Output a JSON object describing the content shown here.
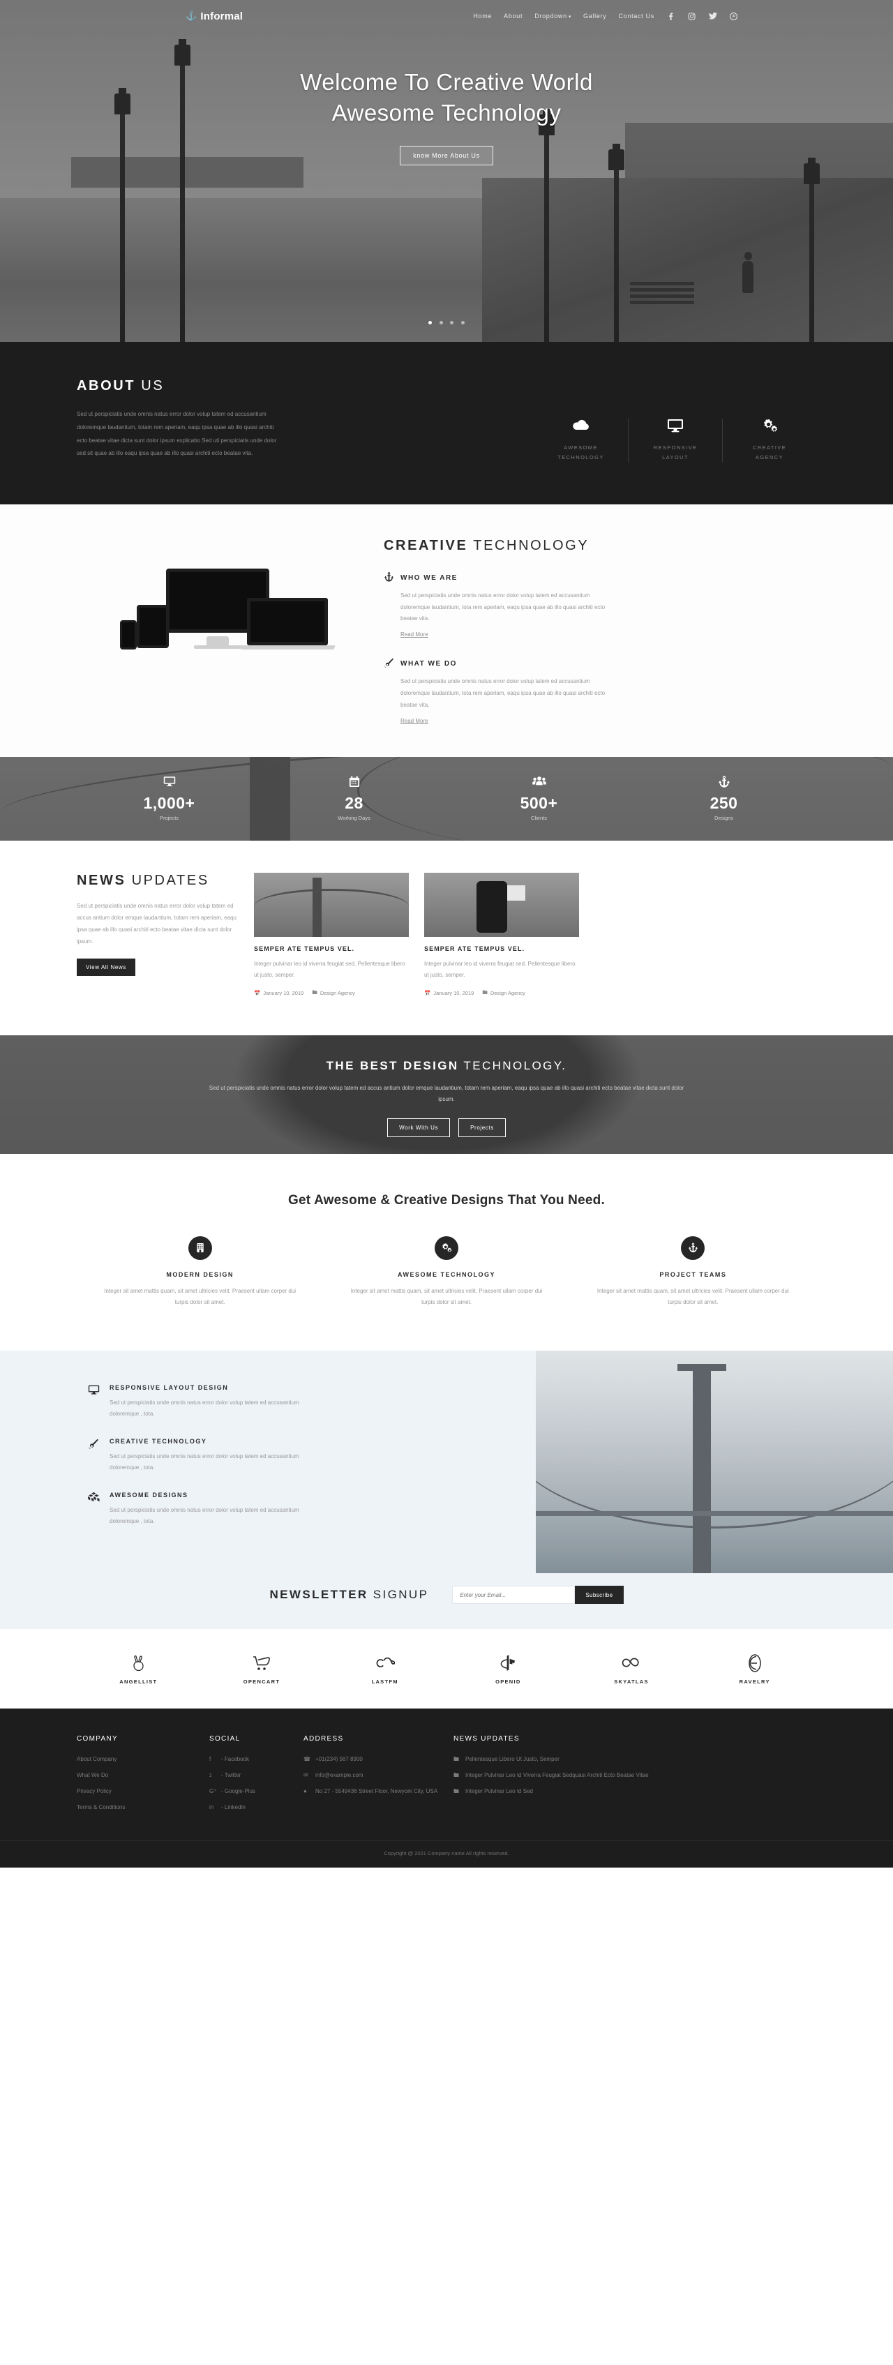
{
  "header": {
    "brand": "Informal",
    "brand_icon": "anchor-icon",
    "nav": [
      {
        "label": "Home"
      },
      {
        "label": "About"
      },
      {
        "label": "Dropdown",
        "caret": "▾"
      },
      {
        "label": "Gallery"
      },
      {
        "label": "Contact Us"
      }
    ],
    "social": [
      {
        "name": "facebook-icon",
        "glyph": "f"
      },
      {
        "name": "instagram-icon",
        "glyph": "▣"
      },
      {
        "name": "twitter-icon",
        "glyph": "ᴠ"
      },
      {
        "name": "pinterest-icon",
        "glyph": "ⓟ"
      }
    ]
  },
  "hero": {
    "line1": "Welcome To Creative World",
    "line2": "Awesome Technology",
    "button": "know More About Us",
    "slides": 4,
    "active_slide": 1
  },
  "about": {
    "title_bold": "ABOUT",
    "title_light": "US",
    "body": "Sed ut perspiciatis unde omnis natus error dolor volup tatem ed accusantium doloremque laudantium, totam rem aperiam, eaqu ipsa quae ab illo quasi architi ecto beatae vitae dicta sunt dolor ipsum explicabo Sed uti perspiciatis unde dolor sed sit quae ab illo eaqu ipsa quae ab illo quasi architi ecto beatae vita.",
    "features": [
      {
        "icon": "cloud-icon",
        "glyph": "☁",
        "label": "AWESOME\nTECHNOLOGY"
      },
      {
        "icon": "monitor-icon",
        "glyph": "▢",
        "label": "RESPONSIVE\nLAYOUT"
      },
      {
        "icon": "gears-icon",
        "glyph": "⚙",
        "label": "CREATIVE\nAGENCY"
      }
    ]
  },
  "creative": {
    "title_bold": "CREATIVE",
    "title_light": "TECHNOLOGY",
    "items": [
      {
        "icon": "anchor-icon",
        "glyph": "⚓",
        "heading": "WHO WE ARE",
        "body": "Sed ut perspiciatis unde omnis natus error dolor volup tatem ed accusantium doloremque laudantium, tota rem aperiam, eaqu ipsa quae ab illo quasi architi ecto beatae vita.",
        "link": "Read More"
      },
      {
        "icon": "megaphone-icon",
        "glyph": "📣",
        "heading": "WHAT WE DO",
        "body": "Sed ut perspiciatis unde omnis natus error dolor volup tatem ed accusantium doloremque laudantium, tota rem aperiam, eaqu ipsa quae ab illo quasi architi ecto beatae vita.",
        "link": "Read More"
      }
    ]
  },
  "counters": [
    {
      "icon": "monitor-icon",
      "glyph": "▢",
      "number": "1,000+",
      "label": "Projects"
    },
    {
      "icon": "calendar-icon",
      "glyph": "▦",
      "number": "28",
      "label": "Working Days"
    },
    {
      "icon": "users-icon",
      "glyph": "⛭",
      "number": "500+",
      "label": "Clients"
    },
    {
      "icon": "anchor-icon",
      "glyph": "⚓",
      "number": "250",
      "label": "Designs"
    }
  ],
  "news": {
    "title_bold": "NEWS",
    "title_light": "UPDATES",
    "body": "Sed ut perspiciatis unde omnis natus error dolor volup tatem ed accus antium dolor emque laudantium, totam rem aperiam, eaqu ipsa quae ab illo quasi architi ecto beatae vitae dicta sunt dolor ipsum.",
    "button": "View All News",
    "cards": [
      {
        "image": "bridge-photo",
        "title": "SEMPER ATE TEMPUS VEL.",
        "body": "Integer pulvinar leo id viverra feugiat sed. Pellentesque libero ut justo, semper.",
        "date": "January 10, 2019",
        "category": "Design Agency"
      },
      {
        "image": "person-photo",
        "title": "SEMPER ATE TEMPUS VEL.",
        "body": "Integer pulvinar leo id viverra feugiat sed. Pellentesque libero ut justo, semper.",
        "date": "January 10, 2019",
        "category": "Design Agency"
      }
    ]
  },
  "cta": {
    "title_bold": "THE BEST DESIGN",
    "title_light": "TECHNOLOGY.",
    "body": "Sed ut perspiciatis unde omnis natus error dolor volup tatem ed accus antium dolor emque laudantium, totam rem aperiam, eaqu ipsa quae ab illo quasi architi ecto beatae vitae dicta sunt dolor ipsum.",
    "button_primary": "Work With Us",
    "button_secondary": "Projects"
  },
  "services": {
    "heading": "Get Awesome & Creative Designs That You Need.",
    "items": [
      {
        "icon": "building-icon",
        "glyph": "☷",
        "title": "MODERN DESIGN",
        "body": "Integer sit amet mattis quam, sit amet ultricies velit. Praesent ullam corper dui turpis dolor sit amet."
      },
      {
        "icon": "gears-icon",
        "glyph": "⚙",
        "title": "AWESOME TECHNOLOGY",
        "body": "Integer sit amet mattis quam, sit amet ultricies velit. Praesent ullam corper dui turpis dolor sit amet."
      },
      {
        "icon": "anchor-icon",
        "glyph": "⚓",
        "title": "PROJECT TEAMS",
        "body": "Integer sit amet mattis quam, sit amet ultricies velit. Praesent ullam corper dui turpis dolor sit amet."
      }
    ]
  },
  "feature_list": [
    {
      "icon": "monitor-icon",
      "glyph": "▢",
      "title": "RESPONSIVE LAYOUT DESIGN",
      "body": "Sed ut perspiciatis unde omnis natus error dolor volup tatem ed accusantium doloremque , tota."
    },
    {
      "icon": "megaphone-icon",
      "glyph": "📣",
      "title": "CREATIVE TECHNOLOGY",
      "body": "Sed ut perspiciatis unde omnis natus error dolor volup tatem ed accusantium doloremque , tota."
    },
    {
      "icon": "cubes-icon",
      "glyph": "⬛",
      "title": "AWESOME DESIGNS",
      "body": "Sed ut perspiciatis unde omnis natus error dolor volup tatem ed accusantium doloremque , tota."
    }
  ],
  "newsletter": {
    "title_bold": "NEWSLETTER",
    "title_light": "SIGNUP",
    "placeholder": "Enter your Email...",
    "value": "",
    "button": "Subscribe"
  },
  "brands": [
    {
      "name": "angellist-icon",
      "glyph": "✌",
      "label": "ANGELLIST"
    },
    {
      "name": "opencart-icon",
      "glyph": "⛟",
      "label": "OPENCART"
    },
    {
      "name": "lastfm-icon",
      "glyph": "αѕ",
      "label": "LASTFM"
    },
    {
      "name": "openid-icon",
      "glyph": "ɕ",
      "label": "OPENID"
    },
    {
      "name": "skyatlas-icon",
      "glyph": "∞",
      "label": "SKYATLAS"
    },
    {
      "name": "ravelry-icon",
      "glyph": "Ɛ",
      "label": "RAVELRY"
    }
  ],
  "footer": {
    "columns": [
      {
        "heading": "COMPANY",
        "items": [
          {
            "text": "About Company"
          },
          {
            "text": "What We Do"
          },
          {
            "text": "Privacy Policy"
          },
          {
            "text": "Terms & Conditions"
          }
        ]
      },
      {
        "heading": "SOCIAL",
        "items": [
          {
            "icon": "facebook-icon",
            "glyph": "f",
            "text": "- Facebook"
          },
          {
            "icon": "twitter-icon",
            "glyph": "ᴠ",
            "text": "- Twitter"
          },
          {
            "icon": "google-plus-icon",
            "glyph": "G⁺",
            "text": "- Google-Plus"
          },
          {
            "icon": "linkedin-icon",
            "glyph": "in",
            "text": "- Linkedin"
          }
        ]
      },
      {
        "heading": "ADDRESS",
        "items": [
          {
            "icon": "phone-icon",
            "glyph": "✆",
            "text": "+01(234) 567 8900"
          },
          {
            "icon": "mail-icon",
            "glyph": "✉",
            "text": "info@example.com"
          },
          {
            "icon": "pin-icon",
            "glyph": "◉",
            "text": "No 27 - 5549436 Street Floor, Newyork City, USA"
          }
        ]
      },
      {
        "heading": "NEWS UPDATES",
        "items": [
          {
            "icon": "folder-icon",
            "glyph": "❐",
            "text": "Pellentesque Libero Ut Justo, Semper"
          },
          {
            "icon": "folder-icon",
            "glyph": "❐",
            "text": "Integer Pulvinar Leo Id Viverra Feugiat Sedquasi Architi Ecto Beatae Vitae"
          },
          {
            "icon": "folder-icon",
            "glyph": "❐",
            "text": "Integer Pulvinar Leo Id Sed"
          }
        ]
      }
    ],
    "copyright": "Copyright @ 2021 Company name All rights reserved."
  },
  "colors": {
    "dark": "#1d1d1d",
    "accent_light": "#eef3f8",
    "text_muted": "#9a9a9a"
  }
}
